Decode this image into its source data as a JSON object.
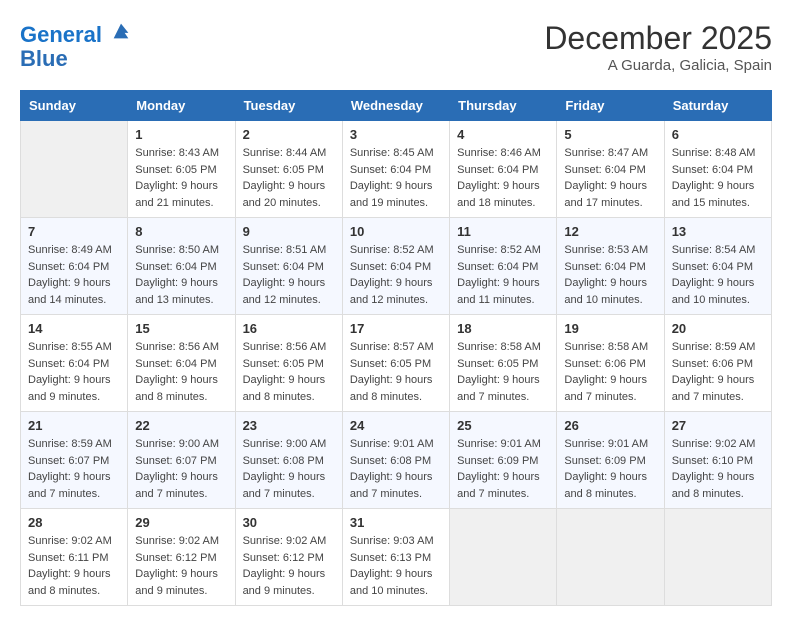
{
  "logo": {
    "line1": "General",
    "line2": "Blue"
  },
  "title": "December 2025",
  "location": "A Guarda, Galicia, Spain",
  "weekdays": [
    "Sunday",
    "Monday",
    "Tuesday",
    "Wednesday",
    "Thursday",
    "Friday",
    "Saturday"
  ],
  "weeks": [
    [
      {
        "day": "",
        "info": ""
      },
      {
        "day": "1",
        "info": "Sunrise: 8:43 AM\nSunset: 6:05 PM\nDaylight: 9 hours\nand 21 minutes."
      },
      {
        "day": "2",
        "info": "Sunrise: 8:44 AM\nSunset: 6:05 PM\nDaylight: 9 hours\nand 20 minutes."
      },
      {
        "day": "3",
        "info": "Sunrise: 8:45 AM\nSunset: 6:04 PM\nDaylight: 9 hours\nand 19 minutes."
      },
      {
        "day": "4",
        "info": "Sunrise: 8:46 AM\nSunset: 6:04 PM\nDaylight: 9 hours\nand 18 minutes."
      },
      {
        "day": "5",
        "info": "Sunrise: 8:47 AM\nSunset: 6:04 PM\nDaylight: 9 hours\nand 17 minutes."
      },
      {
        "day": "6",
        "info": "Sunrise: 8:48 AM\nSunset: 6:04 PM\nDaylight: 9 hours\nand 15 minutes."
      }
    ],
    [
      {
        "day": "7",
        "info": "Sunrise: 8:49 AM\nSunset: 6:04 PM\nDaylight: 9 hours\nand 14 minutes."
      },
      {
        "day": "8",
        "info": "Sunrise: 8:50 AM\nSunset: 6:04 PM\nDaylight: 9 hours\nand 13 minutes."
      },
      {
        "day": "9",
        "info": "Sunrise: 8:51 AM\nSunset: 6:04 PM\nDaylight: 9 hours\nand 12 minutes."
      },
      {
        "day": "10",
        "info": "Sunrise: 8:52 AM\nSunset: 6:04 PM\nDaylight: 9 hours\nand 12 minutes."
      },
      {
        "day": "11",
        "info": "Sunrise: 8:52 AM\nSunset: 6:04 PM\nDaylight: 9 hours\nand 11 minutes."
      },
      {
        "day": "12",
        "info": "Sunrise: 8:53 AM\nSunset: 6:04 PM\nDaylight: 9 hours\nand 10 minutes."
      },
      {
        "day": "13",
        "info": "Sunrise: 8:54 AM\nSunset: 6:04 PM\nDaylight: 9 hours\nand 10 minutes."
      }
    ],
    [
      {
        "day": "14",
        "info": "Sunrise: 8:55 AM\nSunset: 6:04 PM\nDaylight: 9 hours\nand 9 minutes."
      },
      {
        "day": "15",
        "info": "Sunrise: 8:56 AM\nSunset: 6:04 PM\nDaylight: 9 hours\nand 8 minutes."
      },
      {
        "day": "16",
        "info": "Sunrise: 8:56 AM\nSunset: 6:05 PM\nDaylight: 9 hours\nand 8 minutes."
      },
      {
        "day": "17",
        "info": "Sunrise: 8:57 AM\nSunset: 6:05 PM\nDaylight: 9 hours\nand 8 minutes."
      },
      {
        "day": "18",
        "info": "Sunrise: 8:58 AM\nSunset: 6:05 PM\nDaylight: 9 hours\nand 7 minutes."
      },
      {
        "day": "19",
        "info": "Sunrise: 8:58 AM\nSunset: 6:06 PM\nDaylight: 9 hours\nand 7 minutes."
      },
      {
        "day": "20",
        "info": "Sunrise: 8:59 AM\nSunset: 6:06 PM\nDaylight: 9 hours\nand 7 minutes."
      }
    ],
    [
      {
        "day": "21",
        "info": "Sunrise: 8:59 AM\nSunset: 6:07 PM\nDaylight: 9 hours\nand 7 minutes."
      },
      {
        "day": "22",
        "info": "Sunrise: 9:00 AM\nSunset: 6:07 PM\nDaylight: 9 hours\nand 7 minutes."
      },
      {
        "day": "23",
        "info": "Sunrise: 9:00 AM\nSunset: 6:08 PM\nDaylight: 9 hours\nand 7 minutes."
      },
      {
        "day": "24",
        "info": "Sunrise: 9:01 AM\nSunset: 6:08 PM\nDaylight: 9 hours\nand 7 minutes."
      },
      {
        "day": "25",
        "info": "Sunrise: 9:01 AM\nSunset: 6:09 PM\nDaylight: 9 hours\nand 7 minutes."
      },
      {
        "day": "26",
        "info": "Sunrise: 9:01 AM\nSunset: 6:09 PM\nDaylight: 9 hours\nand 8 minutes."
      },
      {
        "day": "27",
        "info": "Sunrise: 9:02 AM\nSunset: 6:10 PM\nDaylight: 9 hours\nand 8 minutes."
      }
    ],
    [
      {
        "day": "28",
        "info": "Sunrise: 9:02 AM\nSunset: 6:11 PM\nDaylight: 9 hours\nand 8 minutes."
      },
      {
        "day": "29",
        "info": "Sunrise: 9:02 AM\nSunset: 6:12 PM\nDaylight: 9 hours\nand 9 minutes."
      },
      {
        "day": "30",
        "info": "Sunrise: 9:02 AM\nSunset: 6:12 PM\nDaylight: 9 hours\nand 9 minutes."
      },
      {
        "day": "31",
        "info": "Sunrise: 9:03 AM\nSunset: 6:13 PM\nDaylight: 9 hours\nand 10 minutes."
      },
      {
        "day": "",
        "info": ""
      },
      {
        "day": "",
        "info": ""
      },
      {
        "day": "",
        "info": ""
      }
    ]
  ]
}
